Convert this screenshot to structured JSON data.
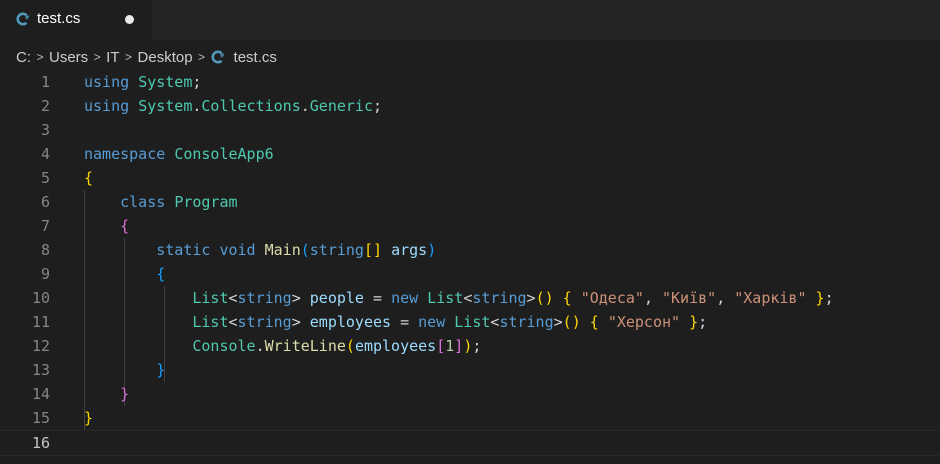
{
  "tab": {
    "filename": "test.cs",
    "icon": "csharp-icon",
    "dirty": true
  },
  "breadcrumb": {
    "items": [
      "C:",
      "Users",
      "IT",
      "Desktop",
      "test.cs"
    ]
  },
  "editor": {
    "active_line": 16,
    "lines": [
      {
        "n": "1",
        "text": "using System;"
      },
      {
        "n": "2",
        "text": "using System.Collections.Generic;"
      },
      {
        "n": "3",
        "text": ""
      },
      {
        "n": "4",
        "text": "namespace ConsoleApp6"
      },
      {
        "n": "5",
        "text": "{"
      },
      {
        "n": "6",
        "text": "    class Program"
      },
      {
        "n": "7",
        "text": "    {"
      },
      {
        "n": "8",
        "text": "        static void Main(string[] args)"
      },
      {
        "n": "9",
        "text": "        {"
      },
      {
        "n": "10",
        "text": "            List<string> people = new List<string>() { \"Одеса\", \"Київ\", \"Харків\" };"
      },
      {
        "n": "11",
        "text": "            List<string> employees = new List<string>() { \"Херсон\" };"
      },
      {
        "n": "12",
        "text": "            Console.WriteLine(employees[1]);"
      },
      {
        "n": "13",
        "text": "        }"
      },
      {
        "n": "14",
        "text": "    }"
      },
      {
        "n": "15",
        "text": "}"
      },
      {
        "n": "16",
        "text": ""
      }
    ]
  },
  "theme": {
    "background": "#1e1e1e",
    "tabbar": "#252526",
    "keyword": "#569cd6",
    "type": "#4ec9b0",
    "string": "#ce9178",
    "control": "#c586c0"
  }
}
